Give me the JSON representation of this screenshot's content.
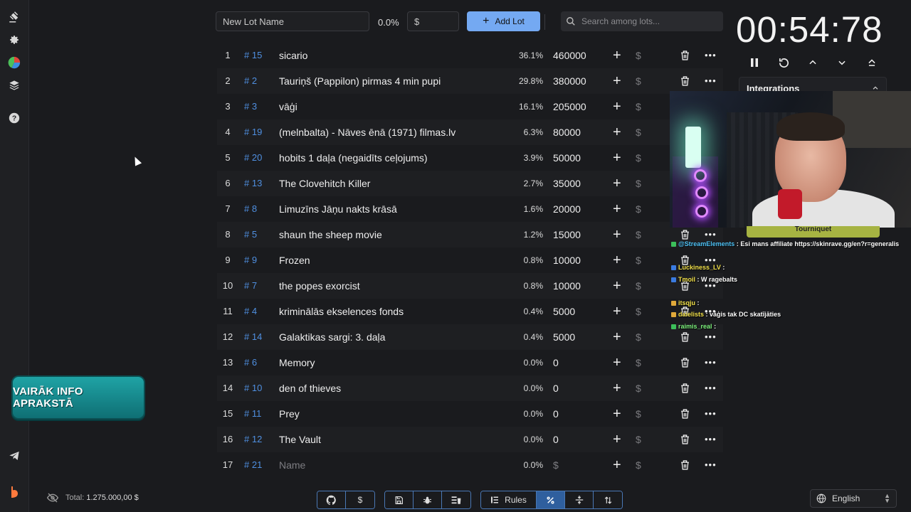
{
  "sidebar": {
    "items": [
      {
        "icon": "gavel-icon"
      },
      {
        "icon": "gear-icon"
      },
      {
        "icon": "pie-chart-icon"
      },
      {
        "icon": "layers-icon"
      },
      {
        "icon": "help-icon"
      },
      {
        "icon": "telegram-icon"
      },
      {
        "icon": "brand-icon"
      }
    ]
  },
  "promo": {
    "text": "VAIRĀK INFO APRAKSTĀ"
  },
  "toolbar": {
    "lot_name_placeholder": "New Lot Name",
    "percent": "0.0%",
    "amount_placeholder": "$",
    "add_lot_label": "Add Lot",
    "search_placeholder": "Search among lots..."
  },
  "lots": [
    {
      "index": "1",
      "id": "# 15",
      "name": "sicario",
      "percent": "36.1%",
      "amount": "460000"
    },
    {
      "index": "2",
      "id": "# 2",
      "name": "Tauriņš (Pappilon) pirmas 4 min pupi",
      "percent": "29.8%",
      "amount": "380000"
    },
    {
      "index": "3",
      "id": "# 3",
      "name": "vāģi",
      "percent": "16.1%",
      "amount": "205000"
    },
    {
      "index": "4",
      "id": "# 19",
      "name": "(melnbalta) - Nāves ēnā (1971) filmas.lv",
      "percent": "6.3%",
      "amount": "80000"
    },
    {
      "index": "5",
      "id": "# 20",
      "name": "hobits 1 daļa (negaidīts ceļojums)",
      "percent": "3.9%",
      "amount": "50000"
    },
    {
      "index": "6",
      "id": "# 13",
      "name": "The Clovehitch Killer",
      "percent": "2.7%",
      "amount": "35000"
    },
    {
      "index": "7",
      "id": "# 8",
      "name": "Limuzīns Jāņu nakts krāsā",
      "percent": "1.6%",
      "amount": "20000"
    },
    {
      "index": "8",
      "id": "# 5",
      "name": "shaun the sheep movie",
      "percent": "1.2%",
      "amount": "15000"
    },
    {
      "index": "9",
      "id": "# 9",
      "name": "Frozen",
      "percent": "0.8%",
      "amount": "10000"
    },
    {
      "index": "10",
      "id": "# 7",
      "name": "the popes exorcist",
      "percent": "0.8%",
      "amount": "10000"
    },
    {
      "index": "11",
      "id": "# 4",
      "name": "kriminālās ekselences fonds",
      "percent": "0.4%",
      "amount": "5000"
    },
    {
      "index": "12",
      "id": "# 14",
      "name": "Galaktikas sargi: 3. daļa",
      "percent": "0.4%",
      "amount": "5000"
    },
    {
      "index": "13",
      "id": "# 6",
      "name": "Memory",
      "percent": "0.0%",
      "amount": "0"
    },
    {
      "index": "14",
      "id": "# 10",
      "name": "den of thieves",
      "percent": "0.0%",
      "amount": "0"
    },
    {
      "index": "15",
      "id": "# 11",
      "name": "Prey",
      "percent": "0.0%",
      "amount": "0"
    },
    {
      "index": "16",
      "id": "# 12",
      "name": "The Vault",
      "percent": "0.0%",
      "amount": "0"
    },
    {
      "index": "17",
      "id": "# 21",
      "name": "Name",
      "percent": "0.0%",
      "amount": "$"
    }
  ],
  "row_actions": {
    "plus": "+",
    "currency": "$",
    "more": "•••"
  },
  "timer": {
    "value": "00:54:78"
  },
  "integrations": {
    "title": "Integrations"
  },
  "overlay": {
    "tourniquet": "Tourniquet",
    "chat": [
      {
        "user": "@StreamElements",
        "text": ": Esi mans affiliate https://skinrave.gg/en?r=generalis",
        "color": "#4fc3f7"
      },
      {
        "user": "Luckiness_LV",
        "text": ":",
        "color": "#f2e14b"
      },
      {
        "user": "Tmoil",
        "text": ": W ragebalts",
        "color": "#f2e14b"
      },
      {
        "user": "itsqju",
        "text": ":",
        "color": "#f2e14b"
      },
      {
        "user": "daielists",
        "text": ": vāģis tak DC skatījāties",
        "color": "#f2e14b"
      },
      {
        "user": "raimis_real",
        "text": ":",
        "color": "#7cf27c"
      }
    ]
  },
  "footer": {
    "total_label": "Total:",
    "total_value": "1.275.000,00 $",
    "rules_label": "Rules",
    "language": "English"
  }
}
